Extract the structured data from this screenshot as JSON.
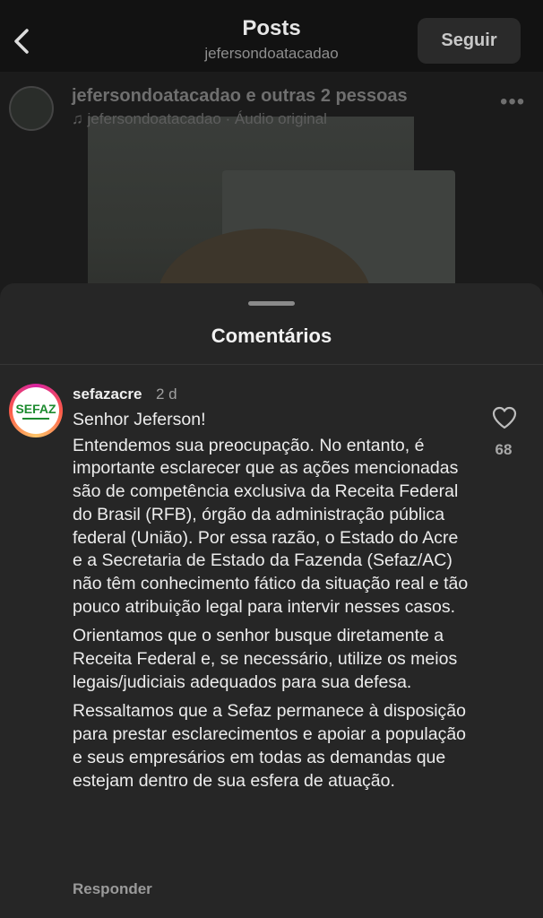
{
  "header": {
    "title": "Posts",
    "subtitle": "jefersondoatacadao",
    "follow_label": "Seguir"
  },
  "post": {
    "users": "jefersondoatacadao e outras 2 pessoas",
    "audio": "jefersondoatacadao · Áudio original",
    "more": "•••"
  },
  "comments_sheet": {
    "title": "Comentários",
    "comment": {
      "avatar_text": "SEFAZ",
      "username": "sefazacre",
      "time": "2 d",
      "paragraphs": [
        "Senhor Jeferson!",
        "Entendemos sua preocupação. No entanto, é importante esclarecer que as ações mencionadas são de competência exclusiva da Receita Federal do Brasil (RFB), órgão da administração pública federal (União). Por essa razão, o Estado do Acre e a Secretaria de Estado da Fazenda (Sefaz/AC) não têm conhecimento fático da situação real e tão pouco atribuição legal para intervir nesses casos.",
        "Orientamos que o senhor busque diretamente a Receita Federal e, se necessário, utilize os meios legais/judiciais adequados para sua defesa.",
        "Ressaltamos que a Sefaz permanece à disposição para prestar esclarecimentos e apoiar a população e seus empresários em todas as demandas que estejam dentro de sua esfera de atuação."
      ],
      "reply_label": "Responder",
      "likes": "68"
    }
  },
  "icons": [
    "back-chevron-icon",
    "music-note-icon",
    "more-options-icon",
    "heart-icon"
  ],
  "colors": {
    "sheet_bg": "#262626",
    "header_bg": "#121212",
    "sefaz_green": "#1d8b2f"
  }
}
